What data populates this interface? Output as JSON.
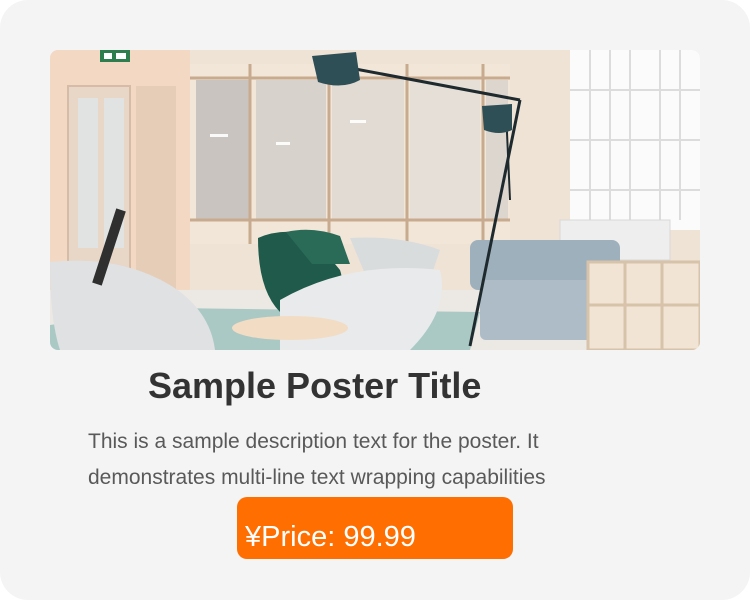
{
  "poster": {
    "title": "Sample Poster Title",
    "description_lines": [
      "This is a sample description text for the poster. It",
      "demonstrates multi-line text wrapping capabilities"
    ],
    "price_label": "¥Price: 99.99"
  },
  "colors": {
    "background": "#f4f4f4",
    "title": "#333333",
    "description": "#595959",
    "price_button": "#ff6e00",
    "price_text": "#ffffff"
  },
  "icons": {
    "exit_sign": "exit-sign-icon"
  }
}
